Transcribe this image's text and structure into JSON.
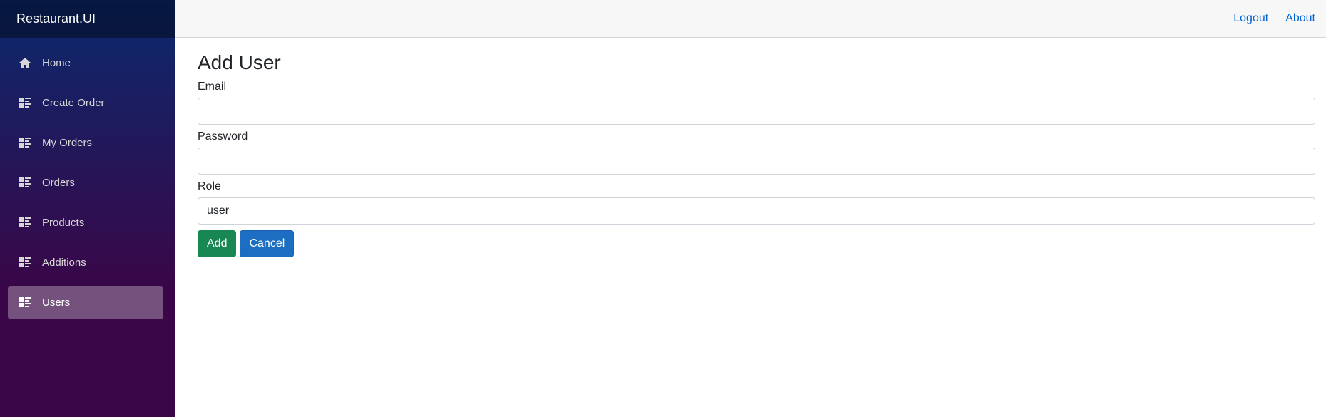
{
  "brand": "Restaurant.UI",
  "nav": {
    "items": [
      {
        "label": "Home",
        "icon": "home-icon",
        "active": false
      },
      {
        "label": "Create Order",
        "icon": "list-icon",
        "active": false
      },
      {
        "label": "My Orders",
        "icon": "list-icon",
        "active": false
      },
      {
        "label": "Orders",
        "icon": "list-icon",
        "active": false
      },
      {
        "label": "Products",
        "icon": "list-icon",
        "active": false
      },
      {
        "label": "Additions",
        "icon": "list-icon",
        "active": false
      },
      {
        "label": "Users",
        "icon": "list-icon",
        "active": true
      }
    ]
  },
  "top_links": {
    "logout": "Logout",
    "about": "About"
  },
  "page": {
    "title": "Add User",
    "email_label": "Email",
    "email_value": "",
    "password_label": "Password",
    "password_value": "",
    "role_label": "Role",
    "role_value": "user",
    "add_label": "Add",
    "cancel_label": "Cancel"
  },
  "colors": {
    "link": "#0366d6",
    "add_button": "#198754",
    "cancel_button": "#1b6ec2",
    "sidebar_top": "#0a2a6e",
    "sidebar_bottom": "#3a0647"
  }
}
